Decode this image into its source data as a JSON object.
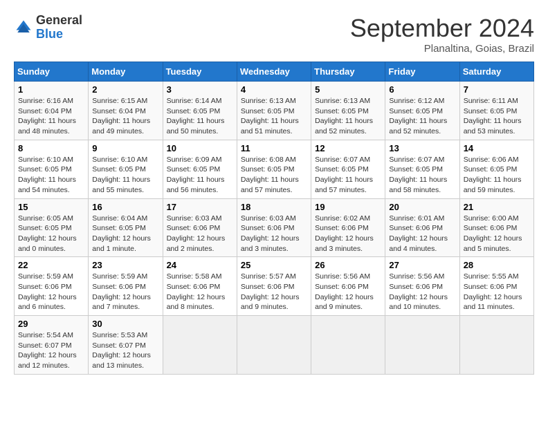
{
  "header": {
    "logo_line1": "General",
    "logo_line2": "Blue",
    "month": "September 2024",
    "location": "Planaltina, Goias, Brazil"
  },
  "weekdays": [
    "Sunday",
    "Monday",
    "Tuesday",
    "Wednesday",
    "Thursday",
    "Friday",
    "Saturday"
  ],
  "days": [
    {
      "num": "1",
      "sunrise": "6:16 AM",
      "sunset": "6:04 PM",
      "daylight": "11 hours and 48 minutes."
    },
    {
      "num": "2",
      "sunrise": "6:15 AM",
      "sunset": "6:04 PM",
      "daylight": "11 hours and 49 minutes."
    },
    {
      "num": "3",
      "sunrise": "6:14 AM",
      "sunset": "6:05 PM",
      "daylight": "11 hours and 50 minutes."
    },
    {
      "num": "4",
      "sunrise": "6:13 AM",
      "sunset": "6:05 PM",
      "daylight": "11 hours and 51 minutes."
    },
    {
      "num": "5",
      "sunrise": "6:13 AM",
      "sunset": "6:05 PM",
      "daylight": "11 hours and 52 minutes."
    },
    {
      "num": "6",
      "sunrise": "6:12 AM",
      "sunset": "6:05 PM",
      "daylight": "11 hours and 52 minutes."
    },
    {
      "num": "7",
      "sunrise": "6:11 AM",
      "sunset": "6:05 PM",
      "daylight": "11 hours and 53 minutes."
    },
    {
      "num": "8",
      "sunrise": "6:10 AM",
      "sunset": "6:05 PM",
      "daylight": "11 hours and 54 minutes."
    },
    {
      "num": "9",
      "sunrise": "6:10 AM",
      "sunset": "6:05 PM",
      "daylight": "11 hours and 55 minutes."
    },
    {
      "num": "10",
      "sunrise": "6:09 AM",
      "sunset": "6:05 PM",
      "daylight": "11 hours and 56 minutes."
    },
    {
      "num": "11",
      "sunrise": "6:08 AM",
      "sunset": "6:05 PM",
      "daylight": "11 hours and 57 minutes."
    },
    {
      "num": "12",
      "sunrise": "6:07 AM",
      "sunset": "6:05 PM",
      "daylight": "11 hours and 57 minutes."
    },
    {
      "num": "13",
      "sunrise": "6:07 AM",
      "sunset": "6:05 PM",
      "daylight": "11 hours and 58 minutes."
    },
    {
      "num": "14",
      "sunrise": "6:06 AM",
      "sunset": "6:05 PM",
      "daylight": "11 hours and 59 minutes."
    },
    {
      "num": "15",
      "sunrise": "6:05 AM",
      "sunset": "6:05 PM",
      "daylight": "12 hours and 0 minutes."
    },
    {
      "num": "16",
      "sunrise": "6:04 AM",
      "sunset": "6:05 PM",
      "daylight": "12 hours and 1 minute."
    },
    {
      "num": "17",
      "sunrise": "6:03 AM",
      "sunset": "6:06 PM",
      "daylight": "12 hours and 2 minutes."
    },
    {
      "num": "18",
      "sunrise": "6:03 AM",
      "sunset": "6:06 PM",
      "daylight": "12 hours and 3 minutes."
    },
    {
      "num": "19",
      "sunrise": "6:02 AM",
      "sunset": "6:06 PM",
      "daylight": "12 hours and 3 minutes."
    },
    {
      "num": "20",
      "sunrise": "6:01 AM",
      "sunset": "6:06 PM",
      "daylight": "12 hours and 4 minutes."
    },
    {
      "num": "21",
      "sunrise": "6:00 AM",
      "sunset": "6:06 PM",
      "daylight": "12 hours and 5 minutes."
    },
    {
      "num": "22",
      "sunrise": "5:59 AM",
      "sunset": "6:06 PM",
      "daylight": "12 hours and 6 minutes."
    },
    {
      "num": "23",
      "sunrise": "5:59 AM",
      "sunset": "6:06 PM",
      "daylight": "12 hours and 7 minutes."
    },
    {
      "num": "24",
      "sunrise": "5:58 AM",
      "sunset": "6:06 PM",
      "daylight": "12 hours and 8 minutes."
    },
    {
      "num": "25",
      "sunrise": "5:57 AM",
      "sunset": "6:06 PM",
      "daylight": "12 hours and 9 minutes."
    },
    {
      "num": "26",
      "sunrise": "5:56 AM",
      "sunset": "6:06 PM",
      "daylight": "12 hours and 9 minutes."
    },
    {
      "num": "27",
      "sunrise": "5:56 AM",
      "sunset": "6:06 PM",
      "daylight": "12 hours and 10 minutes."
    },
    {
      "num": "28",
      "sunrise": "5:55 AM",
      "sunset": "6:06 PM",
      "daylight": "12 hours and 11 minutes."
    },
    {
      "num": "29",
      "sunrise": "5:54 AM",
      "sunset": "6:07 PM",
      "daylight": "12 hours and 12 minutes."
    },
    {
      "num": "30",
      "sunrise": "5:53 AM",
      "sunset": "6:07 PM",
      "daylight": "12 hours and 13 minutes."
    }
  ],
  "start_dow": 0
}
